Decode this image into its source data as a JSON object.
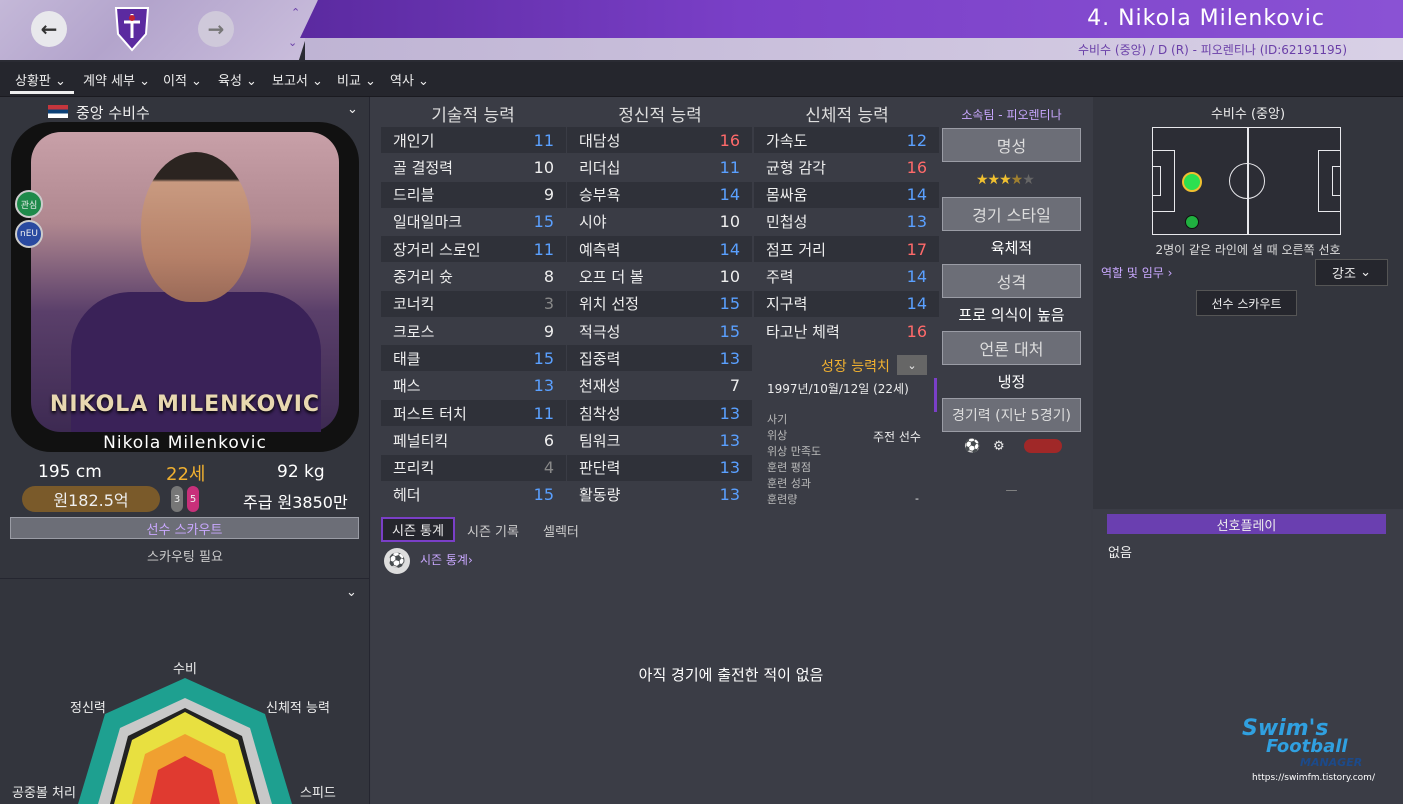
{
  "header": {
    "player_title": "4. Nikola Milenkovic",
    "subtitle": "수비수 (중앙) / D (R) - 피오렌티나 (ID:62191195)",
    "back_icon": "arrow-left-icon",
    "forward_icon": "arrow-right-icon",
    "crest_icon": "fiorentina-crest-icon"
  },
  "menu": {
    "items": [
      "상황판",
      "계약 세부",
      "이적",
      "육성",
      "보고서",
      "비교",
      "역사"
    ]
  },
  "profile": {
    "position": "중앙 수비수",
    "photo_name_overlay": "NIKOLA MILENKOVIC",
    "name": "Nikola Milenkovic",
    "height": "195 cm",
    "age": "22세",
    "weight": "92 kg",
    "value": "원182.5억",
    "wage": "주급 원3850만",
    "badge1": "관심",
    "badge2": "nEU",
    "foot_left": "3",
    "foot_right": "5",
    "scout_button": "선수 스카우트",
    "scout_note": "스카우팅 필요"
  },
  "radar": {
    "labels": {
      "top": "수비",
      "top_right": "신체적 능력",
      "right": "스피드",
      "left": "공중볼 처리",
      "top_left": "정신력"
    }
  },
  "attributes": {
    "technical": {
      "header": "기술적 능력",
      "rows": [
        [
          "개인기",
          "11",
          "blue"
        ],
        [
          "골 결정력",
          "10",
          "white"
        ],
        [
          "드리블",
          "9",
          "white"
        ],
        [
          "일대일마크",
          "15",
          "blue"
        ],
        [
          "장거리 스로인",
          "11",
          "blue"
        ],
        [
          "중거리 슛",
          "8",
          "white"
        ],
        [
          "코너킥",
          "3",
          "grey"
        ],
        [
          "크로스",
          "9",
          "white"
        ],
        [
          "태클",
          "15",
          "blue"
        ],
        [
          "패스",
          "13",
          "blue"
        ],
        [
          "퍼스트 터치",
          "11",
          "blue"
        ],
        [
          "페널티킥",
          "6",
          "white"
        ],
        [
          "프리킥",
          "4",
          "grey"
        ],
        [
          "헤더",
          "15",
          "blue"
        ]
      ]
    },
    "mental": {
      "header": "정신적 능력",
      "rows": [
        [
          "대담성",
          "16",
          "red"
        ],
        [
          "리더십",
          "11",
          "blue"
        ],
        [
          "승부욕",
          "14",
          "blue"
        ],
        [
          "시야",
          "10",
          "white"
        ],
        [
          "예측력",
          "14",
          "blue"
        ],
        [
          "오프 더 볼",
          "10",
          "white"
        ],
        [
          "위치 선정",
          "15",
          "blue"
        ],
        [
          "적극성",
          "15",
          "blue"
        ],
        [
          "집중력",
          "13",
          "blue"
        ],
        [
          "천재성",
          "7",
          "white"
        ],
        [
          "침착성",
          "13",
          "blue"
        ],
        [
          "팀워크",
          "13",
          "blue"
        ],
        [
          "판단력",
          "13",
          "blue"
        ],
        [
          "활동량",
          "13",
          "blue"
        ]
      ]
    },
    "physical": {
      "header": "신체적 능력",
      "rows": [
        [
          "가속도",
          "12",
          "blue"
        ],
        [
          "균형 감각",
          "16",
          "red"
        ],
        [
          "몸싸움",
          "14",
          "blue"
        ],
        [
          "민첩성",
          "13",
          "blue"
        ],
        [
          "점프 거리",
          "17",
          "red"
        ],
        [
          "주력",
          "14",
          "blue"
        ],
        [
          "지구력",
          "14",
          "blue"
        ],
        [
          "타고난 체력",
          "16",
          "red"
        ]
      ]
    }
  },
  "growth": {
    "title": "성장 능력치",
    "dob": "1997년/10월/12일 (22세)",
    "labels": [
      "사기",
      "위상",
      "위상 만족도",
      "훈련 평점",
      "훈련 성과",
      "훈련량"
    ],
    "status_value": "주전 선수",
    "training_value": "-"
  },
  "side": {
    "club": "소속팀 - 피오렌티나",
    "reputation_btn": "명성",
    "stars": 3.5,
    "style_btn": "경기 스타일",
    "style_val": "육체적",
    "personality_btn": "성격",
    "personality_val": "프로 의식이 높음",
    "media_btn": "언론 대처",
    "media_val": "냉정",
    "form_btn": "경기력 (지난 5경기)",
    "form_empty": "—"
  },
  "position_panel": {
    "title": "수비수 (중앙)",
    "note": "2명이 같은 라인에 설 때 오른쪽 선호",
    "roles_link": "역할 및 임무 ›",
    "highlight_select": "강조",
    "scout_btn": "선수 스카우트"
  },
  "stats": {
    "tabs": [
      "시즌 통계",
      "시즌 기록",
      "셀렉터"
    ],
    "link": "시즌 통계›",
    "empty": "아직 경기에 출전한 적이 없음"
  },
  "preferred": {
    "title": "선호플레이",
    "value": "없음"
  },
  "watermark": {
    "line1": "Swim's",
    "line2": "Football",
    "line3": "MANAGER",
    "url": "https://swimfm.tistory.com/"
  },
  "colors": {
    "accent": "#7a3fc7",
    "blue": "#5aa0ff",
    "red": "#ff6a6a",
    "gold": "#f0b030"
  }
}
